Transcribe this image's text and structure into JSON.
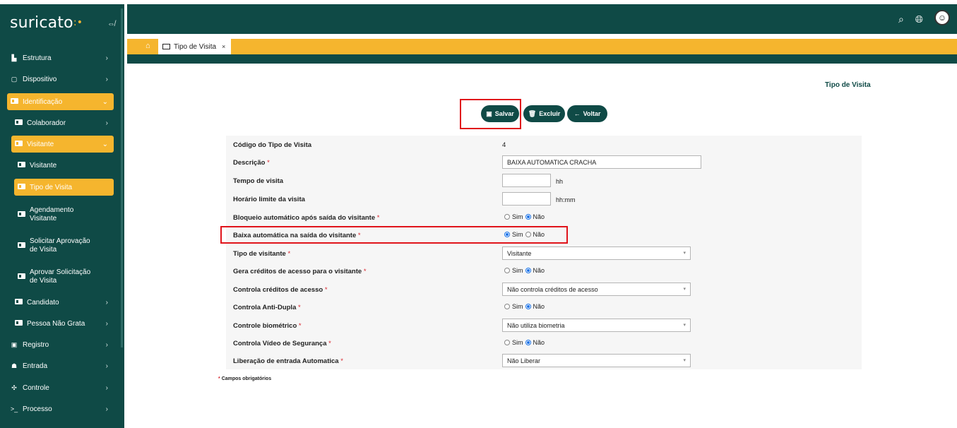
{
  "app": {
    "brand": "suricato",
    "brand_dots": ":•"
  },
  "sidebar": {
    "items": [
      {
        "label": "Estrutura",
        "icon": "building-icon"
      },
      {
        "label": "Dispositivo",
        "icon": "device-icon"
      },
      {
        "label": "Identificação",
        "icon": "id-card-icon"
      },
      {
        "label": "Colaborador",
        "icon": "id-card-icon"
      },
      {
        "label": "Visitante",
        "icon": "id-card-icon"
      },
      {
        "label": "Visitante",
        "icon": "id-card-icon"
      },
      {
        "label": "Tipo de Visita",
        "icon": "id-card-icon"
      },
      {
        "label_line1": "Agendamento",
        "label_line2": "Visitante",
        "icon": "id-card-icon"
      },
      {
        "label_line1": "Solicitar Aprovação",
        "label_line2": "de Visita",
        "icon": "id-card-icon"
      },
      {
        "label_line1": "Aprovar Solicitação",
        "label_line2": "de Visita",
        "icon": "id-card-icon"
      },
      {
        "label": "Candidato",
        "icon": "id-card-icon"
      },
      {
        "label": "Pessoa Não Grata",
        "icon": "id-card-icon"
      },
      {
        "label": "Registro",
        "icon": "register-icon"
      },
      {
        "label": "Entrada",
        "icon": "users-icon"
      },
      {
        "label": "Controle",
        "icon": "puzzle-icon"
      },
      {
        "label": "Processo",
        "icon": "terminal-icon"
      }
    ]
  },
  "tabs": {
    "active_label": "Tipo de Visita",
    "close": "×"
  },
  "page": {
    "title": "Tipo de Visita",
    "buttons": {
      "save": "Salvar",
      "delete": "Excluir",
      "back": "Voltar"
    },
    "footnote_mark": "*",
    "footnote": "Campos obrigatórios"
  },
  "form": {
    "required_mark": "*",
    "codigo_label": "Código do Tipo de Visita",
    "codigo_value": "4",
    "descricao_label": "Descrição",
    "descricao_value": "BAIXA AUTOMATICA CRACHA",
    "tempo_label": "Tempo de visita",
    "tempo_value": "",
    "tempo_unit": "hh",
    "horario_label": "Horário limite da visita",
    "horario_value": "",
    "horario_unit": "hh:mm",
    "bloqueio_label": "Bloqueio automático após saída do visitante",
    "baixa_label": "Baixa automática na saída do visitante",
    "tipo_visitante_label": "Tipo de visitante",
    "tipo_visitante_value": "Visitante",
    "gera_creditos_label": "Gera créditos de acesso para o visitante",
    "controla_creditos_label": "Controla créditos de acesso",
    "controla_creditos_value": "Não controla créditos de acesso",
    "anti_dupla_label": "Controla Anti-Dupla",
    "biometrico_label": "Controle biométrico",
    "biometrico_value": "Não utiliza biometria",
    "video_label": "Controla Vídeo de Segurança",
    "liberacao_label": "Liberação de entrada Automatica",
    "liberacao_value": "Não Liberar",
    "radio_yes": "Sim",
    "radio_no": "Não",
    "bloqueio_selected": "Não",
    "baixa_selected": "Sim",
    "gera_creditos_selected": "Não",
    "anti_dupla_selected": "Não",
    "video_selected": "Não"
  },
  "colors": {
    "primary": "#0f4a46",
    "accent": "#f5b52e",
    "highlight": "#e0141b"
  }
}
